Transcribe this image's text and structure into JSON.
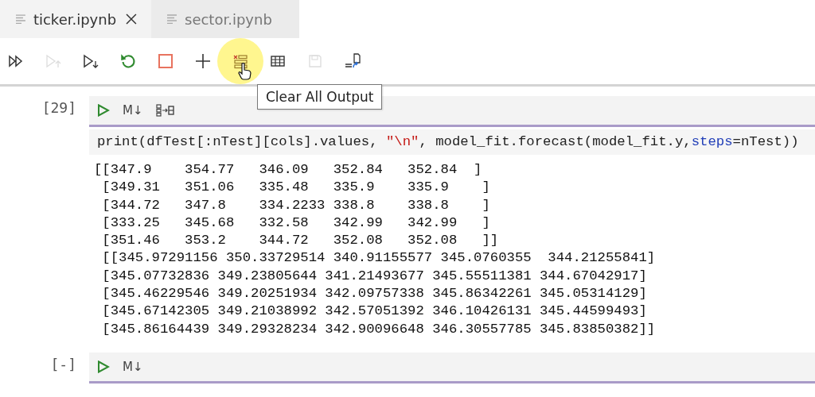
{
  "tabs": [
    {
      "label": "ticker.ipynb",
      "selected": true,
      "closable": true
    },
    {
      "label": "sector.ipynb",
      "selected": false,
      "closable": false
    }
  ],
  "toolbar": [
    {
      "kind": "run-all",
      "disabled": false,
      "hovered": false
    },
    {
      "kind": "run-above",
      "disabled": true,
      "hovered": false
    },
    {
      "kind": "run-below",
      "disabled": false,
      "hovered": false
    },
    {
      "kind": "restart",
      "disabled": false,
      "hovered": false
    },
    {
      "kind": "stop",
      "disabled": false,
      "hovered": false
    },
    {
      "kind": "add",
      "disabled": false,
      "hovered": false
    },
    {
      "kind": "clear-output",
      "disabled": false,
      "hovered": true
    },
    {
      "kind": "table",
      "disabled": false,
      "hovered": false
    },
    {
      "kind": "save",
      "disabled": true,
      "hovered": false
    },
    {
      "kind": "export",
      "disabled": false,
      "hovered": false
    }
  ],
  "tooltip": "Clear All Output",
  "cells": [
    {
      "prompt": "[29]",
      "markdown_toggle": "M↓",
      "split": true,
      "code": [
        {
          "kind": "plain",
          "text": "print(dfTest[:nTest][cols].values, "
        },
        {
          "kind": "string",
          "text": "\"\\n\""
        },
        {
          "kind": "plain",
          "text": ", model_fit.forecast(model_fit.y,"
        },
        {
          "kind": "argument",
          "text": "steps"
        },
        {
          "kind": "plain",
          "text": "=nTest))"
        }
      ],
      "output": [
        "[[347.9    354.77   346.09   352.84   352.84  ]",
        " [349.31   351.06   335.48   335.9    335.9    ]",
        " [344.72   347.8    334.2233 338.8    338.8    ]",
        " [333.25   345.68   332.58   342.99   342.99   ]",
        " [351.46   353.2    344.72   352.08   352.08   ]]",
        " [[345.97291156 350.33729514 340.91155577 345.0760355  344.21255841]",
        " [345.07732836 349.23805644 341.21493677 345.55511381 344.67042917]",
        " [345.46229546 349.20251934 342.09757338 345.86342261 345.05314129]",
        " [345.67142305 349.21038992 342.57051392 346.10426131 345.44599493]",
        " [345.86164439 349.29328234 342.90096648 346.30557785 345.83850382]]"
      ]
    },
    {
      "prompt": "[-]",
      "markdown_toggle": "M↓",
      "split": false
    }
  ]
}
